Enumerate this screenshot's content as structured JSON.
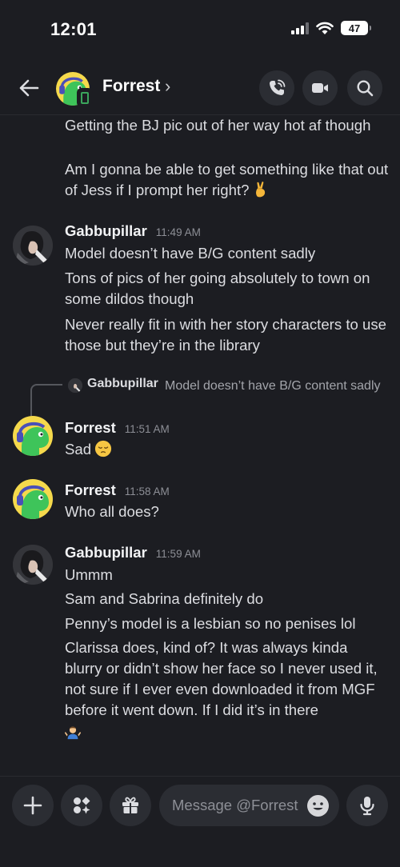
{
  "status_bar": {
    "time": "12:01",
    "battery": "47"
  },
  "header": {
    "name": "Forrest",
    "chevron": "›"
  },
  "messages": [
    {
      "continuation_lines": [
        "Getting the BJ pic out of her way hot af though",
        "Am I gonna be able to get something like that out of Jess if I prompt her right?"
      ]
    },
    {
      "author": "Gabbupillar",
      "time": "11:49 AM",
      "lines": [
        "Model doesn’t have B/G content sadly",
        "Tons of pics of her going absolutely to town on some dildos though",
        "Never really fit in with her story characters to use those but they’re in the library"
      ]
    },
    {
      "reply": {
        "author": "Gabbupillar",
        "text": "Model doesn’t have B/G content sadly"
      },
      "author": "Forrest",
      "time": "11:51 AM",
      "lines": [
        "Sad"
      ]
    },
    {
      "author": "Forrest",
      "time": "11:58 AM",
      "lines": [
        "Who all does?"
      ]
    },
    {
      "author": "Gabbupillar",
      "time": "11:59 AM",
      "lines": [
        "Ummm",
        "Sam and Sabrina definitely do",
        "Penny’s model is a lesbian so no penises lol",
        "Clarissa does, kind of? It was always kinda blurry or didn’t show her face so I never used it, not sure if I ever even downloaded it from MGF before it went down. If I did it’s in there"
      ]
    }
  ],
  "composer": {
    "placeholder": "Message @Forrest"
  },
  "icons": {
    "back": "arrow-left-icon",
    "call": "phone-call-icon",
    "video": "video-camera-icon",
    "search": "search-icon",
    "add": "plus-icon",
    "apps": "apps-icon",
    "gift": "gift-icon",
    "emoji": "emoji-icon",
    "mic": "microphone-icon",
    "crossed_fingers": "crossed-fingers-emoji",
    "pensive": "pensive-face-emoji",
    "shrug": "person-shrugging-emoji"
  },
  "colors": {
    "background": "#1c1d22",
    "surface": "#2b2d33",
    "online": "#3ba55c",
    "forrest_avatar": "#f5d94c"
  }
}
